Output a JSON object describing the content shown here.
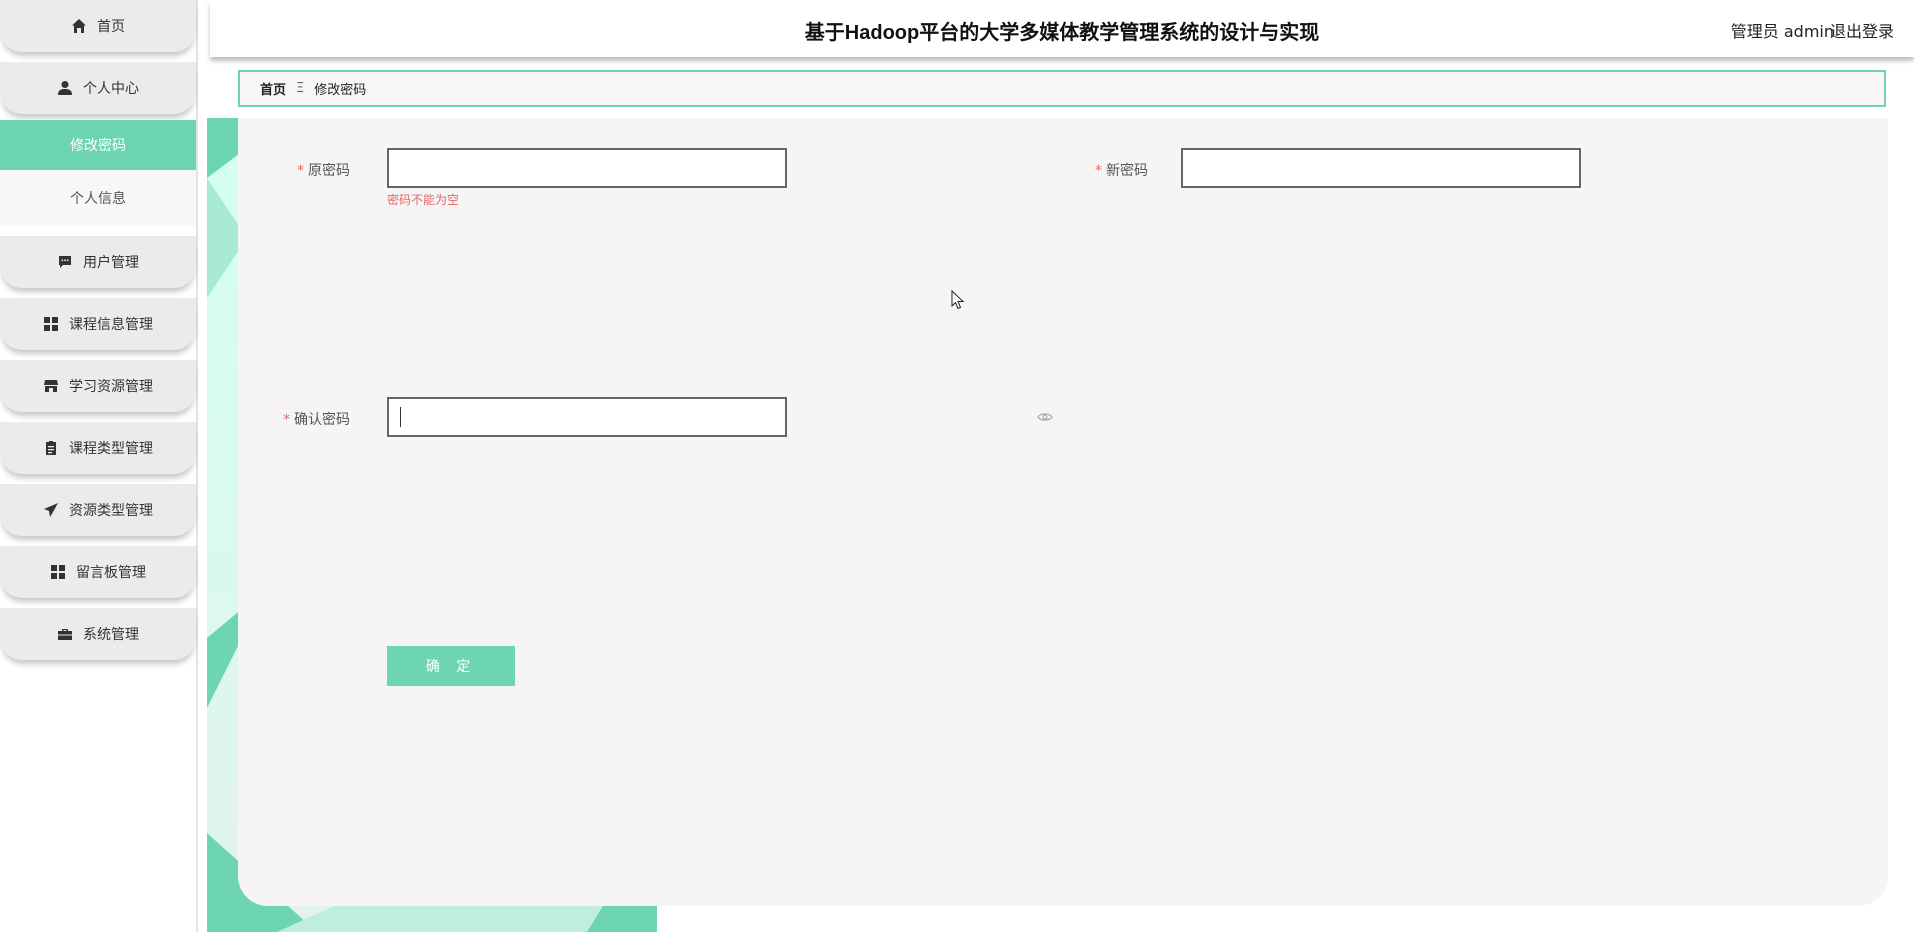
{
  "header": {
    "title": "基于Hadoop平台的大学多媒体教学管理系统的设计与实现",
    "user": "管理员 admin",
    "logout": "退出登录"
  },
  "sidebar": {
    "items": [
      {
        "label": "首页",
        "icon": "home-icon"
      },
      {
        "label": "个人中心",
        "icon": "user-icon"
      },
      {
        "label": "用户管理",
        "icon": "chat-icon"
      },
      {
        "label": "课程信息管理",
        "icon": "grid-icon"
      },
      {
        "label": "学习资源管理",
        "icon": "store-icon"
      },
      {
        "label": "课程类型管理",
        "icon": "clipboard-icon"
      },
      {
        "label": "资源类型管理",
        "icon": "send-icon"
      },
      {
        "label": "留言板管理",
        "icon": "grid-icon"
      },
      {
        "label": "系统管理",
        "icon": "briefcase-icon"
      }
    ],
    "submenu": [
      {
        "label": "修改密码",
        "active": true
      },
      {
        "label": "个人信息",
        "active": false
      }
    ]
  },
  "breadcrumb": {
    "home": "首页",
    "separator": "Ξ",
    "current": "修改密码"
  },
  "form": {
    "required_mark": "*",
    "old_password": {
      "label": "原密码",
      "value": "",
      "error": "密码不能为空"
    },
    "new_password": {
      "label": "新密码",
      "value": ""
    },
    "confirm_password": {
      "label": "确认密码",
      "value": ""
    },
    "submit_label": "确 定"
  },
  "colors": {
    "accent": "#6dd5b2",
    "error": "#e06b6b",
    "card_bg": "#f6f4f4"
  }
}
